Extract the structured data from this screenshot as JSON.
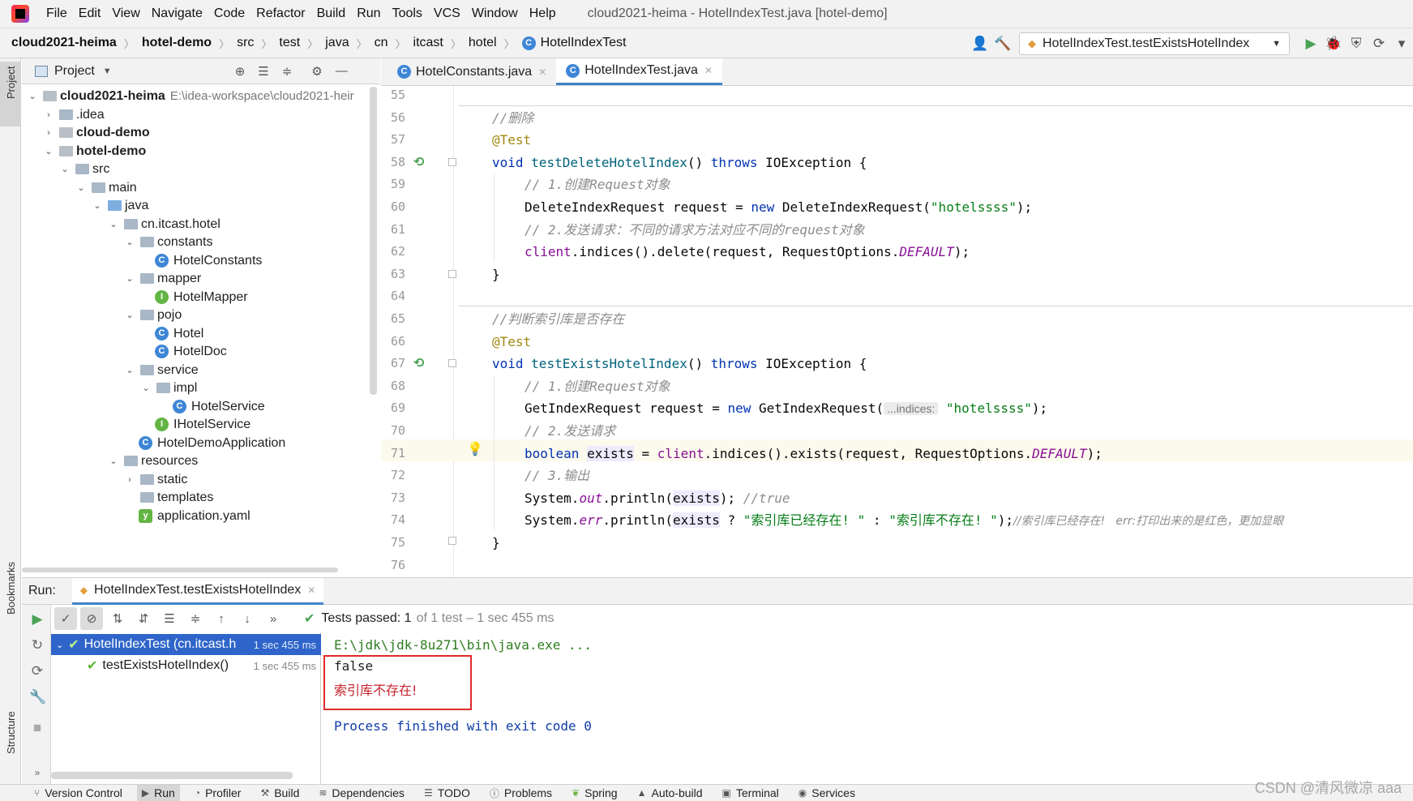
{
  "window_title": "cloud2021-heima - HotelIndexTest.java [hotel-demo]",
  "menu": [
    "File",
    "Edit",
    "View",
    "Navigate",
    "Code",
    "Refactor",
    "Build",
    "Run",
    "Tools",
    "VCS",
    "Window",
    "Help"
  ],
  "breadcrumbs": [
    "cloud2021-heima",
    "hotel-demo",
    "src",
    "test",
    "java",
    "cn",
    "itcast",
    "hotel",
    "HotelIndexTest"
  ],
  "run_config": "HotelIndexTest.testExistsHotelIndex",
  "left_stripe": {
    "project": "Project",
    "bookmarks": "Bookmarks",
    "structure": "Structure"
  },
  "project_panel": {
    "title": "Project",
    "tree": [
      {
        "label": "cloud2021-heima",
        "path": "E:\\idea-workspace\\cloud2021-heir"
      },
      {
        "label": ".idea"
      },
      {
        "label": "cloud-demo"
      },
      {
        "label": "hotel-demo"
      },
      {
        "label": "src"
      },
      {
        "label": "main"
      },
      {
        "label": "java"
      },
      {
        "label": "cn.itcast.hotel"
      },
      {
        "label": "constants"
      },
      {
        "label": "HotelConstants"
      },
      {
        "label": "mapper"
      },
      {
        "label": "HotelMapper"
      },
      {
        "label": "pojo"
      },
      {
        "label": "Hotel"
      },
      {
        "label": "HotelDoc"
      },
      {
        "label": "service"
      },
      {
        "label": "impl"
      },
      {
        "label": "HotelService"
      },
      {
        "label": "IHotelService"
      },
      {
        "label": "HotelDemoApplication"
      },
      {
        "label": "resources"
      },
      {
        "label": "static"
      },
      {
        "label": "templates"
      },
      {
        "label": "application.yaml"
      }
    ]
  },
  "editor": {
    "tabs": [
      "HotelConstants.java",
      "HotelIndexTest.java"
    ],
    "active_tab": "HotelIndexTest.java",
    "line_numbers": [
      "55",
      "56",
      "57",
      "58",
      "59",
      "60",
      "61",
      "62",
      "63",
      "64",
      "65",
      "66",
      "67",
      "68",
      "69",
      "70",
      "71",
      "72",
      "73",
      "74",
      "75",
      "76"
    ],
    "code": {
      "l56": "//删除",
      "l57": "@Test",
      "l58_kw": "void",
      "l58_fn": "testDeleteHotelIndex",
      "l58_rest": "() ",
      "l58_throws": "throws",
      "l58_exc": " IOException {",
      "l59": "// 1.创建Request对象",
      "l60_a": "DeleteIndexRequest request = ",
      "l60_new": "new",
      "l60_b": " DeleteIndexRequest(",
      "l60_str": "\"hotelssss\"",
      "l60_c": ");",
      "l61": "// 2.发送请求：不同的请求方法对应不同的request对象",
      "l62_a": "client",
      "l62_b": ".indices().delete(request, RequestOptions.",
      "l62_field": "DEFAULT",
      "l62_c": ");",
      "l63": "}",
      "l65": "//判断索引库是否存在",
      "l66": "@Test",
      "l67_kw": "void",
      "l67_fn": "testExistsHotelIndex",
      "l67_rest": "() ",
      "l67_throws": "throws",
      "l67_exc": " IOException {",
      "l68": "// 1.创建Request对象",
      "l69_a": "GetIndexRequest request = ",
      "l69_new": "new",
      "l69_b": " GetIndexRequest(",
      "l69_hint": "...indices:",
      "l69_str": "\"hotelssss\"",
      "l69_c": ");",
      "l70": "// 2.发送请求",
      "l71_kw": "boolean",
      "l71_var": "exists",
      "l71_a": " = ",
      "l71_client": "client",
      "l71_b": ".indices().exists(request, RequestOptions.",
      "l71_field": "DEFAULT",
      "l71_c": ");",
      "l72": "// 3.输出",
      "l73_a": "System.",
      "l73_out": "out",
      "l73_b": ".println(",
      "l73_var": "exists",
      "l73_c": "); ",
      "l73_cm": "//true",
      "l74_a": "System.",
      "l74_err": "err",
      "l74_b": ".println(",
      "l74_var": "exists",
      "l74_c": " ? ",
      "l74_s1": "\"索引库已经存在! \"",
      "l74_d": " : ",
      "l74_s2": "\"索引库不存在! \"",
      "l74_e": ");",
      "l74_cm": "//索引库已经存在!   err:打印出来的是红色，更加显眼",
      "l75": "}"
    }
  },
  "run_panel": {
    "label": "Run:",
    "tab": "HotelIndexTest.testExistsHotelIndex",
    "status_main": "Tests passed: 1",
    "status_muted": "of 1 test – 1 sec 455 ms",
    "tests": [
      {
        "name": "HotelIndexTest (cn.itcast.h",
        "time": "1 sec 455 ms"
      },
      {
        "name": "testExistsHotelIndex()",
        "time": "1 sec 455 ms"
      }
    ],
    "console": {
      "cmd": "E:\\jdk\\jdk-8u271\\bin\\java.exe ...",
      "out": "false",
      "err": "索引库不存在!",
      "exit": "Process finished with exit code 0"
    }
  },
  "bottom_bar": [
    "Version Control",
    "Run",
    "Profiler",
    "Build",
    "Dependencies",
    "TODO",
    "Problems",
    "Spring",
    "Auto-build",
    "Terminal",
    "Services"
  ],
  "watermark": "CSDN @清风微凉 aaa"
}
